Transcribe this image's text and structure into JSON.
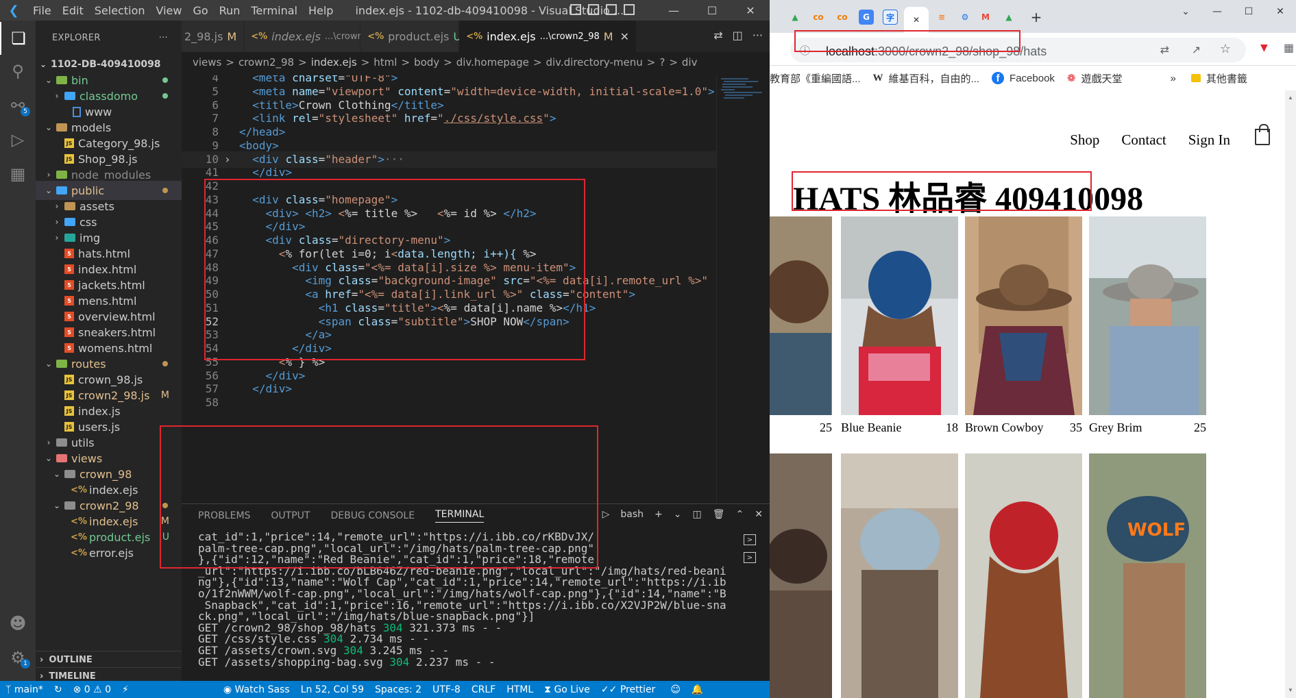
{
  "vscode": {
    "menu": [
      "File",
      "Edit",
      "Selection",
      "View",
      "Go",
      "Run",
      "Terminal",
      "Help"
    ],
    "window_title": "index.ejs - 1102-db-409410098 - Visual Studio ...",
    "explorer": {
      "header": "EXPLORER",
      "root": "1102-DB-409410098",
      "items": [
        {
          "label": "bin",
          "type": "folder-open"
        },
        {
          "label": "classdomo",
          "type": "folder"
        },
        {
          "label": "www",
          "type": "file"
        },
        {
          "label": "models",
          "type": "folder-open"
        },
        {
          "label": "Category_98.js",
          "type": "js"
        },
        {
          "label": "Shop_98.js",
          "type": "js"
        },
        {
          "label": "node_modules",
          "type": "folder"
        },
        {
          "label": "public",
          "type": "folder-open"
        },
        {
          "label": "assets",
          "type": "folder"
        },
        {
          "label": "css",
          "type": "folder"
        },
        {
          "label": "img",
          "type": "folder"
        },
        {
          "label": "hats.html",
          "type": "html"
        },
        {
          "label": "index.html",
          "type": "html"
        },
        {
          "label": "jackets.html",
          "type": "html"
        },
        {
          "label": "mens.html",
          "type": "html"
        },
        {
          "label": "overview.html",
          "type": "html"
        },
        {
          "label": "sneakers.html",
          "type": "html"
        },
        {
          "label": "womens.html",
          "type": "html"
        },
        {
          "label": "routes",
          "type": "folder-open"
        },
        {
          "label": "crown_98.js",
          "type": "js"
        },
        {
          "label": "crown2_98.js",
          "type": "js",
          "status": "M"
        },
        {
          "label": "index.js",
          "type": "js"
        },
        {
          "label": "users.js",
          "type": "js"
        },
        {
          "label": "utils",
          "type": "folder"
        },
        {
          "label": "views",
          "type": "folder-open"
        },
        {
          "label": "crown_98",
          "type": "folder-open"
        },
        {
          "label": "index.ejs",
          "type": "ejs"
        },
        {
          "label": "crown2_98",
          "type": "folder-open"
        },
        {
          "label": "index.ejs",
          "type": "ejs",
          "status": "M"
        },
        {
          "label": "product.ejs",
          "type": "ejs",
          "status": "U"
        },
        {
          "label": "error.ejs",
          "type": "ejs"
        }
      ],
      "outline": "OUTLINE",
      "timeline": "TIMELINE"
    },
    "tabs": [
      {
        "label": "2_98.js",
        "status": "M",
        "icon": "js"
      },
      {
        "label": "index.ejs",
        "sub": "...\\crown_98",
        "icon": "ejs"
      },
      {
        "label": "product.ejs",
        "status": "U",
        "icon": "ejs"
      },
      {
        "label": "index.ejs",
        "sub": "...\\crown2_98",
        "status": "M",
        "icon": "ejs",
        "active": true
      }
    ],
    "breadcrumb": [
      "views",
      ">",
      "crown2_98",
      ">",
      "index.ejs",
      ">",
      "html",
      ">",
      "body",
      ">",
      "div.homepage",
      ">",
      "div.directory-menu",
      ">",
      "?",
      ">",
      "div"
    ],
    "code_lines": [
      {
        "n": "4",
        "html": "  <span class='t'>&lt;meta</span> <span class='a'>charset</span>=<span class='s'>\"UTF-8\"</span><span class='t'>&gt;</span>"
      },
      {
        "n": "5",
        "html": "  <span class='t'>&lt;meta</span> <span class='a'>name</span>=<span class='s'>\"viewport\"</span> <span class='a'>content</span>=<span class='s'>\"width=device-width, initial-scale=1.0\"</span><span class='t'>&gt;</span>"
      },
      {
        "n": "6",
        "html": "  <span class='t'>&lt;title&gt;</span>Crown Clothing<span class='t'>&lt;/title&gt;</span>"
      },
      {
        "n": "7",
        "html": "  <span class='t'>&lt;link</span> <span class='a'>rel</span>=<span class='s'>\"stylesheet\"</span> <span class='a'>href</span>=<span class='s'>\"<u>./css/style.css</u>\"</span><span class='t'>&gt;</span>"
      },
      {
        "n": "8",
        "html": "<span class='t'>&lt;/head&gt;</span>"
      },
      {
        "n": "9",
        "html": "<span class='t'>&lt;body&gt;</span>"
      },
      {
        "n": "10",
        "html": "  <span class='t'>&lt;div</span> <span class='a'>class</span>=<span class='s'>\"header\"</span><span class='t'>&gt;</span><span class='p'>···</span>",
        "fold": true,
        "hl": true
      },
      {
        "n": "41",
        "html": "  <span class='t'>&lt;/div&gt;</span>"
      },
      {
        "n": "42",
        "html": ""
      },
      {
        "n": "43",
        "html": "  <span class='t'>&lt;div</span> <span class='a'>class</span>=<span class='s'>\"homepage\"</span><span class='t'>&gt;</span>"
      },
      {
        "n": "44",
        "html": "    <span class='t'>&lt;div&gt;</span> <span class='t'>&lt;h2&gt;</span> <span class='s'>&lt;</span>%= title %&gt;   <span class='s'>&lt;</span>%= id %&gt; <span class='t'>&lt;/h2&gt;</span>"
      },
      {
        "n": "45",
        "html": "    <span class='t'>&lt;/div&gt;</span>"
      },
      {
        "n": "46",
        "html": "    <span class='t'>&lt;div</span> <span class='a'>class</span>=<span class='s'>\"directory-menu\"</span><span class='t'>&gt;</span>"
      },
      {
        "n": "47",
        "html": "      <span class='s'>&lt;</span>% for(let i=0; i<span class='s'>&lt;</span><span class='a'>data.length; i++){</span> %&gt;"
      },
      {
        "n": "48",
        "html": "        <span class='t'>&lt;div</span> <span class='a'>class</span>=<span class='s'>\"&lt;%= data[i].size %&gt; menu-item\"</span><span class='t'>&gt;</span>"
      },
      {
        "n": "49",
        "html": "          <span class='t'>&lt;img</span> <span class='a'>class</span>=<span class='s'>\"background-image\"</span> <span class='a'>src</span>=<span class='s'>\"&lt;%= data[i].remote_url %&gt;\"</span>"
      },
      {
        "n": "50",
        "html": "          <span class='t'>&lt;a</span> <span class='a'>href</span>=<span class='s'>\"&lt;%= data[i].link_url %&gt;\"</span> <span class='a'>class</span>=<span class='s'>\"content\"</span><span class='t'>&gt;</span>"
      },
      {
        "n": "51",
        "html": "            <span class='t'>&lt;h1</span> <span class='a'>class</span>=<span class='s'>\"title\"</span><span class='t'>&gt;</span><span class='s'>&lt;</span>%= data[i].name %&gt;<span class='t'>&lt;/h1&gt;</span>"
      },
      {
        "n": "52",
        "html": "            <span class='t'>&lt;span</span> <span class='a'>class</span>=<span class='s'>\"subtitle\"</span><span class='t'>&gt;</span>SHOP NOW<span class='t'>&lt;/span&gt;</span>",
        "cur": true
      },
      {
        "n": "53",
        "html": "          <span class='t'>&lt;/a&gt;</span>"
      },
      {
        "n": "54",
        "html": "        <span class='t'>&lt;/div&gt;</span>"
      },
      {
        "n": "55",
        "html": "      <span class='s'>&lt;</span>% } %&gt;"
      },
      {
        "n": "56",
        "html": "    <span class='t'>&lt;/div&gt;</span>"
      },
      {
        "n": "57",
        "html": "  <span class='t'>&lt;/div&gt;</span>"
      },
      {
        "n": "58",
        "html": ""
      }
    ],
    "panel_tabs": [
      "PROBLEMS",
      "OUTPUT",
      "DEBUG CONSOLE",
      "TERMINAL"
    ],
    "panel_actions": {
      "shell": "bash"
    },
    "terminal_lines": [
      "cat_id\":1,\"price\":14,\"remote_url\":\"https://i.ibb.co/rKBDvJX/",
      "palm-tree-cap.png\",\"local_url\":\"/img/hats/palm-tree-cap.png\"",
      "},{\"id\":12,\"name\":\"Red Beanie\",\"cat_id\":1,\"price\":18,\"remote",
      "_url\":\"https://i.ibb.co/bLB646Z/red-beanie.png\",\"local_url\":\"/img/hats/red-beanie.p",
      "ng\"},{\"id\":13,\"name\":\"Wolf Cap\",\"cat_id\":1,\"price\":14,\"remote_url\":\"https://i.ibb.c",
      "o/1f2nWWM/wolf-cap.png\",\"local_url\":\"/img/hats/wolf-cap.png\"},{\"id\":14,\"name\":\"Blue",
      " Snapback\",\"cat_id\":1,\"price\":16,\"remote_url\":\"https://i.ibb.co/X2VJP2W/blue-snapba",
      "ck.png\",\"local_url\":\"/img/hats/blue-snapback.png\"}]"
    ],
    "log_lines": [
      {
        "text": "GET /crown2_98/shop_98/hats ",
        "code": "304",
        "rest": " 321.373 ms - -"
      },
      {
        "text": "GET /css/style.css ",
        "code": "304",
        "rest": " 2.734 ms - -"
      },
      {
        "text": "GET /assets/crown.svg ",
        "code": "304",
        "rest": " 3.245 ms - -"
      },
      {
        "text": "GET /assets/shopping-bag.svg ",
        "code": "304",
        "rest": " 2.237 ms - -"
      }
    ],
    "status": {
      "branch": "main*",
      "problems": "⊗ 0 ⚠ 0",
      "watch": "Watch Sass",
      "position": "Ln 52, Col 59",
      "spaces": "Spaces: 2",
      "encoding": "UTF-8",
      "eol": "CRLF",
      "lang": "HTML",
      "golive": "Go Live",
      "prettier": "Prettier"
    },
    "source_control_badge": "5",
    "settings_badge": "1"
  },
  "browser": {
    "url_host": "localhost",
    "url_path": ":3000/crown2_98/shop_98/hats",
    "bookmarks": [
      "教育部《重編國語...",
      "維基百科，自由的...",
      "Facebook",
      "遊戲天堂",
      "其他書籤"
    ],
    "nav": [
      "Shop",
      "Contact",
      "Sign In"
    ],
    "page_title": "HATS 林品睿 409410098",
    "products": [
      {
        "name": "",
        "price": "25"
      },
      {
        "name": "Blue Beanie",
        "price": "18"
      },
      {
        "name": "Brown Cowboy",
        "price": "35"
      },
      {
        "name": "Grey Brim",
        "price": "25"
      }
    ],
    "colors": {
      "accent": "#e0262f",
      "vscode_blue": "#007acc"
    }
  }
}
